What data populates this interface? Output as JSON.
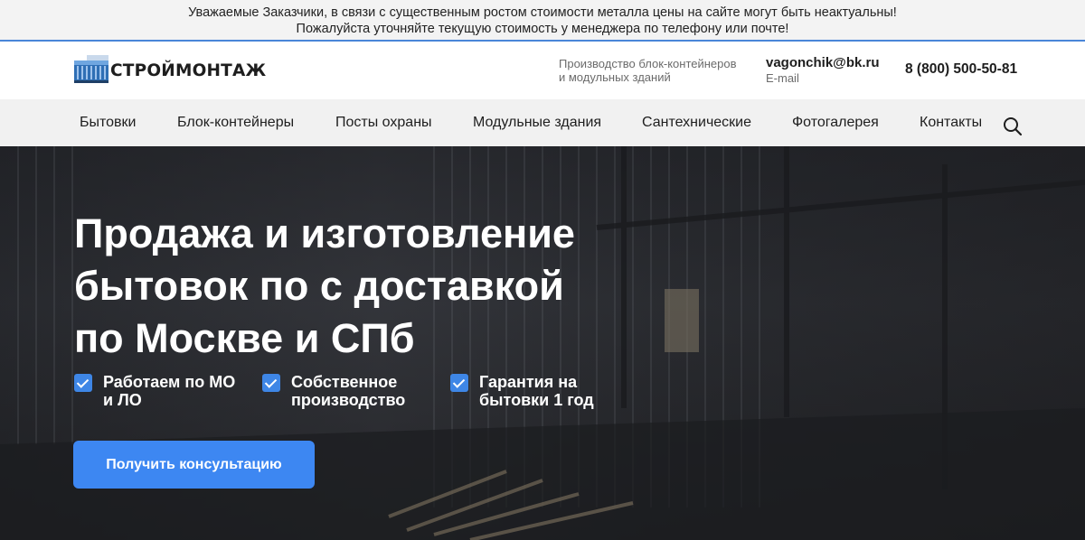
{
  "notice": {
    "line1": "Уважаемые Заказчики, в связи с существенным ростом стоимости металла цены на сайте могут быть неактуальны!",
    "line2": "Пожалуйста уточняйте текущую стоимость у менеджера по телефону или почте!"
  },
  "header": {
    "logo_text": "СТРОЙМОНТАЖ",
    "tagline_line1": "Производство блок-контейнеров",
    "tagline_line2": "и модульных зданий",
    "email": "vagonchik@bk.ru",
    "email_label": "E-mail",
    "phone": "8 (800) 500-50-81"
  },
  "nav": {
    "items": [
      {
        "label": "Бытовки"
      },
      {
        "label": "Блок-контейнеры"
      },
      {
        "label": "Посты охраны"
      },
      {
        "label": "Модульные здания"
      },
      {
        "label": "Сантехнические"
      },
      {
        "label": "Фотогалерея"
      },
      {
        "label": "Контакты"
      }
    ],
    "search_icon": "search-icon"
  },
  "hero": {
    "title_line1": "Продажа и изготовление",
    "title_line2": "бытовок по с доставкой",
    "title_line3": "по Москве и СПб",
    "features": [
      {
        "line1": "Работаем по МО",
        "line2": "и ЛО"
      },
      {
        "line1": "Собственное",
        "line2": "производство"
      },
      {
        "line1": "Гарантия на",
        "line2": "бытовки 1 год"
      }
    ],
    "cta_label": "Получить консультацию"
  },
  "colors": {
    "accent": "#3d87f2",
    "check": "#3e86e6",
    "notice_border": "#4a86d8",
    "nav_bg": "#f1f1f1"
  }
}
